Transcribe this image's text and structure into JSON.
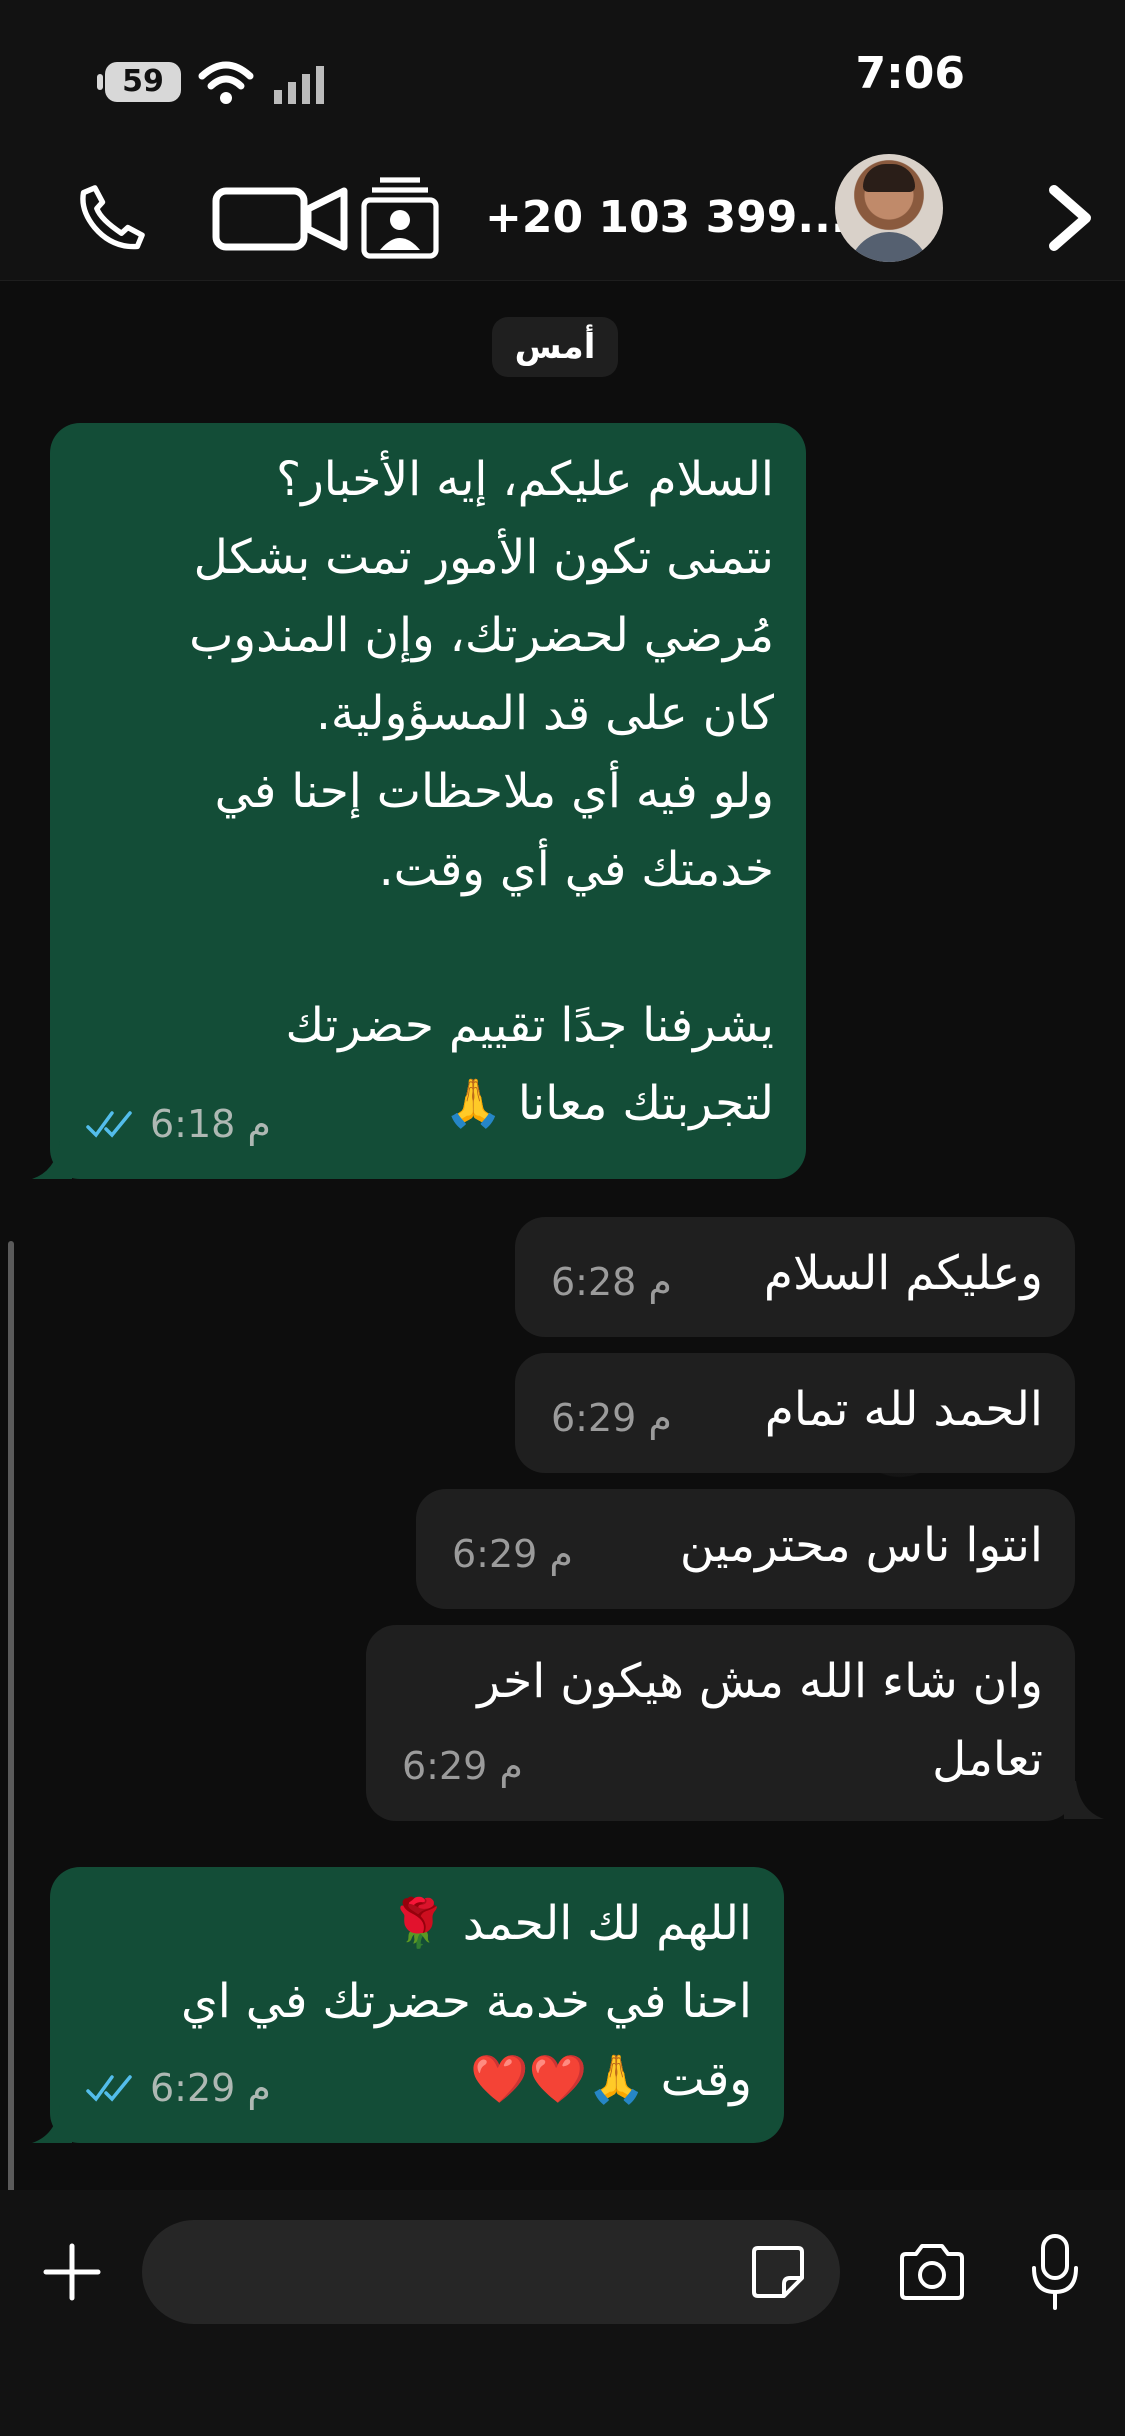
{
  "status_bar": {
    "battery": "59",
    "time": "7:06"
  },
  "header": {
    "contact": "+20 103 399..."
  },
  "chat": {
    "date_separator": "أمس",
    "messages": [
      {
        "dir": "out",
        "text": "السلام عليكم، إيه الأخبار؟\nنتمنى تكون الأمور تمت بشكل\nمُرضي لحضرتك، وإن المندوب\nكان على قد المسؤولية.\nولو فيه أي ملاحظات إحنا في\nخدمتك في أي وقت.\n\nيشرفنا جدًا تقييم حضرتك\nلتجربتك معانا 🙏",
        "time": "6:18 م",
        "status": "read"
      },
      {
        "dir": "in",
        "text": "وعليكم السلام",
        "time": "6:28 م"
      },
      {
        "dir": "in",
        "text": "الحمد لله تمام",
        "time": "6:29 م"
      },
      {
        "dir": "in",
        "text": "انتوا ناس محترمين",
        "time": "6:29 م"
      },
      {
        "dir": "in",
        "text": "وان شاء الله مش هيكون اخر\nتعامل",
        "time": "6:29 م"
      },
      {
        "dir": "out",
        "text": "اللهم لك الحمد 🌹\nاحنا في خدمة حضرتك في اي\nوقت 🙏❤️❤️",
        "time": "6:29 م",
        "status": "read"
      }
    ]
  },
  "composer": {
    "placeholder": ""
  },
  "colors": {
    "outgoing_bubble": "#134d37",
    "incoming_bubble": "#1f1f1f",
    "read_ticks": "#53bdeb"
  }
}
